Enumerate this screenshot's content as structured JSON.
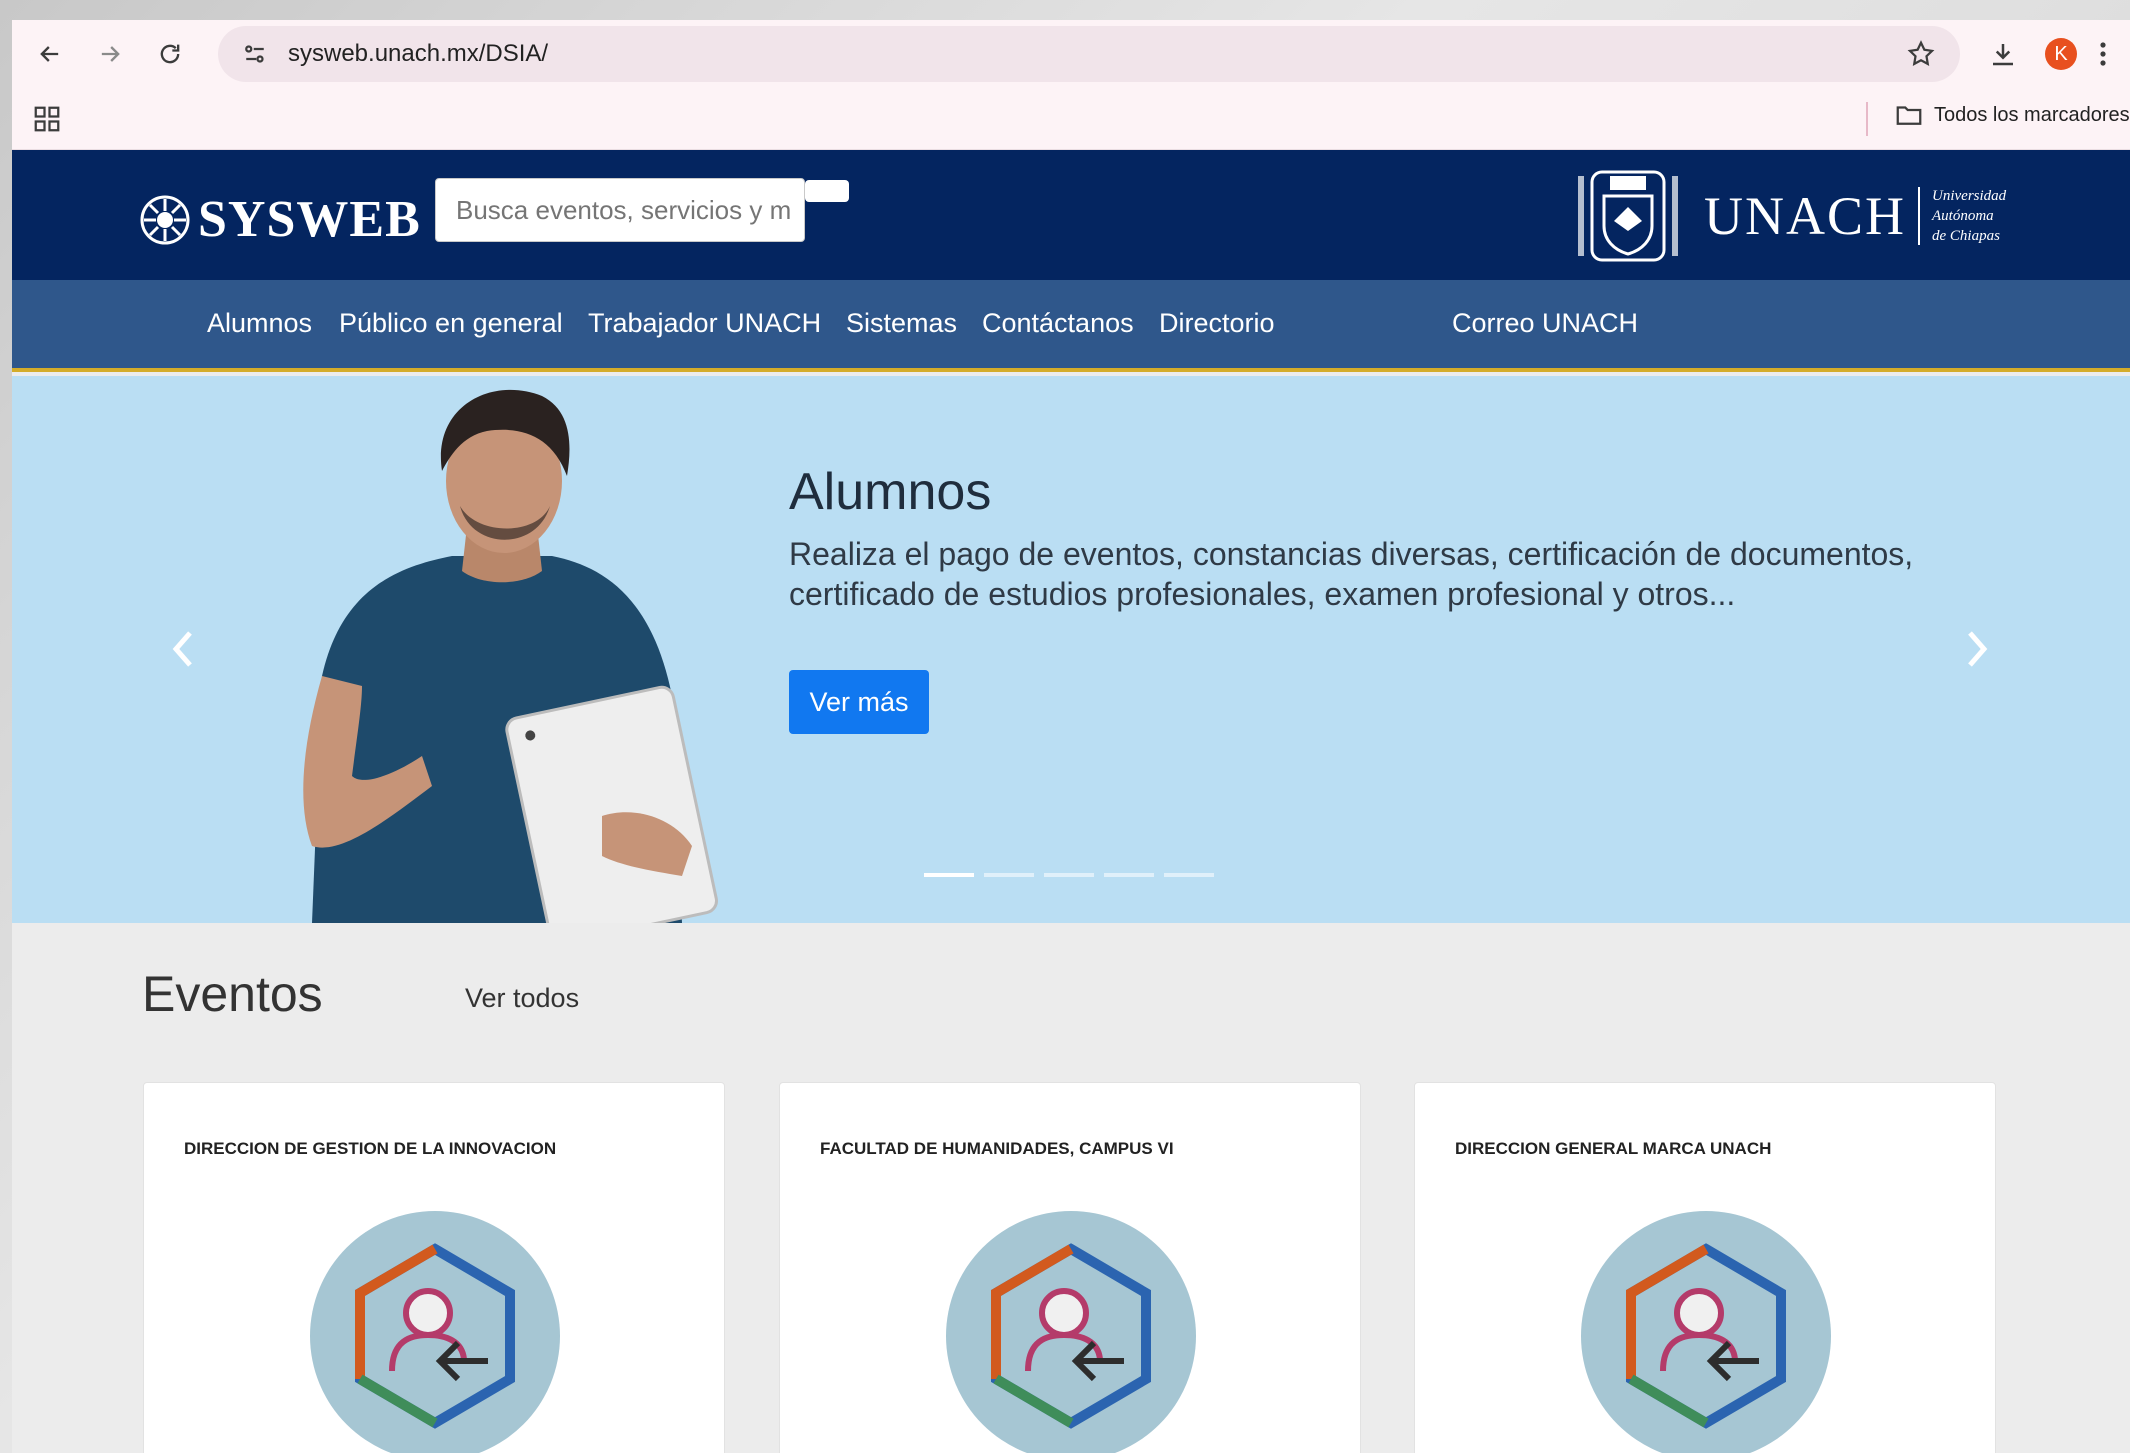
{
  "browser": {
    "url": "sysweb.unach.mx/DSIA/",
    "profile_initial": "K",
    "bookmarks_all": "Todos los marcadores"
  },
  "header": {
    "logo_text": "SYSWEB",
    "search_placeholder": "Busca eventos, servicios y m",
    "unach_name": "UNACH",
    "unach_sub": [
      "Universidad",
      "Autónoma",
      "de Chiapas"
    ]
  },
  "nav": {
    "items": [
      "Alumnos",
      "Público en general",
      "Trabajador UNACH",
      "Sistemas",
      "Contáctanos",
      "Directorio"
    ],
    "correo": "Correo UNACH"
  },
  "carousel": {
    "title": "Alumnos",
    "text": "Realiza el pago de eventos, constancias diversas, certificación de documentos, certificado de estudios profesionales, examen profesional y otros...",
    "button": "Ver más",
    "slides": 5,
    "active_slide": 1
  },
  "events": {
    "title": "Eventos",
    "see_all": "Ver todos",
    "cards": [
      {
        "title": "DIRECCION DE GESTION DE LA INNOVACION"
      },
      {
        "title": "FACULTAD DE HUMANIDADES, CAMPUS VI"
      },
      {
        "title": "DIRECCION GENERAL MARCA UNACH"
      }
    ]
  },
  "colors": {
    "header_bg": "#042560",
    "nav_bg": "#2f578b",
    "nav_border": "#d4ac2a",
    "carousel_bg": "#badef3",
    "button_bg": "#1178f0"
  }
}
